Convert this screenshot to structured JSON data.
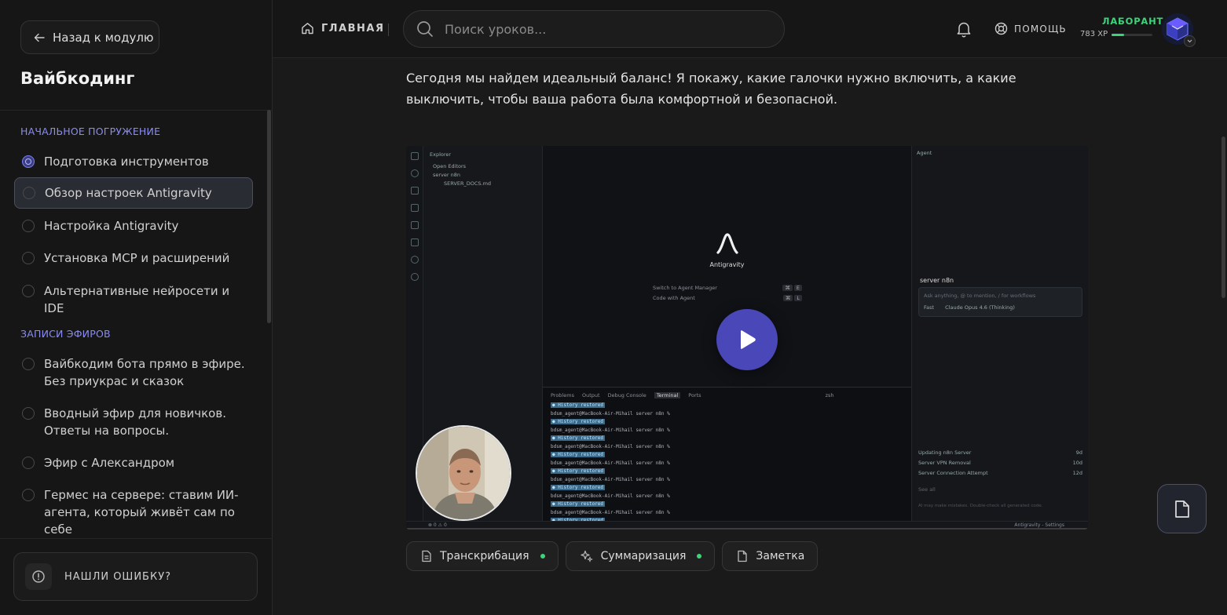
{
  "sidebar": {
    "back_label": "Назад к модулю",
    "course_title": "Вайбкодинг",
    "sections": [
      {
        "title": "НАЧАЛЬНОЕ ПОГРУЖЕНИЕ",
        "lessons": [
          {
            "label": "Подготовка инструментов",
            "status": "done"
          },
          {
            "label": "Обзор настроек Antigravity",
            "status": "active"
          },
          {
            "label": "Настройка Antigravity",
            "status": "todo"
          },
          {
            "label": "Установка MCP и расширений",
            "status": "todo"
          },
          {
            "label": "Альтернативные нейросети и IDE",
            "status": "todo"
          }
        ]
      },
      {
        "title": "ЗАПИСИ ЭФИРОВ",
        "lessons": [
          {
            "label": "Вайбкодим бота прямо в эфире. Без приукрас и сказок",
            "status": "todo"
          },
          {
            "label": "Вводный эфир для новичков. Ответы на вопросы.",
            "status": "todo"
          },
          {
            "label": "Эфир с Александром",
            "status": "todo"
          },
          {
            "label": "Гермес на сервере: ставим ИИ-агента, который живёт сам по себе",
            "status": "todo"
          }
        ]
      }
    ],
    "report_label": "НАШЛИ ОШИБКУ?"
  },
  "header": {
    "home_label": "ГЛАВНАЯ",
    "search_placeholder": "Поиск уроков...",
    "help_label": "ПОМОЩЬ",
    "rank": "ЛАБОРАНТ",
    "xp": "783 XP",
    "xp_progress": 0.3
  },
  "content": {
    "intro": "Сегодня мы найдем идеальный баланс! Я покажу, какие галочки нужно включить, а какие выключить, чтобы ваша работа была комфортной и безопасной.",
    "video": {
      "explorer_title": "Explorer",
      "explorer_items": [
        "Open Editors",
        "server n8n",
        "SERVER_DOCS.md"
      ],
      "brand": "Antigravity",
      "shortcuts": [
        {
          "label": "Switch to Agent Manager",
          "keys": [
            "⌘",
            "E"
          ]
        },
        {
          "label": "Code with Agent",
          "keys": [
            "⌘",
            "L"
          ]
        }
      ],
      "terminal_tabs": [
        "Problems",
        "Output",
        "Debug Console",
        "Terminal",
        "Ports"
      ],
      "terminal_shell": "zsh",
      "terminal_prompt": "bdsm_agent@MacBook-Air-Mihail server n8n %",
      "terminal_tag": "History restored",
      "agent_title": "Agent",
      "agent_server": "server n8n",
      "agent_placeholder": "Ask anything, @ to mention, / for workflows",
      "agent_mode": "Fast",
      "agent_model": "Claude Opus 4.6 (Thinking)",
      "agent_list": [
        {
          "label": "Updating n8n Server",
          "time": "9d"
        },
        {
          "label": "Server VPN Removal",
          "time": "10d"
        },
        {
          "label": "Server Connection Attempt",
          "time": "12d"
        }
      ],
      "agent_see_all": "See all",
      "agent_footer": "AI may make mistakes. Double-check all generated code.",
      "status_right": "Antigravity - Settings",
      "status_left": "⊗ 0 ⚠ 0"
    },
    "tabs": [
      {
        "label": "Транскрибация",
        "dot": true
      },
      {
        "label": "Суммаризация",
        "dot": true
      },
      {
        "label": "Заметка",
        "dot": false
      }
    ]
  },
  "colors": {
    "accent": "#8a8cf0",
    "success": "#3ed37a",
    "play": "#4a48b8"
  }
}
